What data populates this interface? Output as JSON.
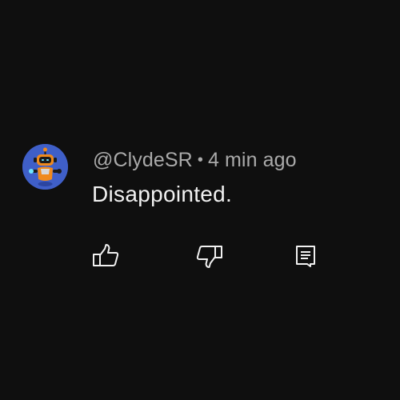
{
  "comment": {
    "author": "@ClydeSR",
    "separator": "•",
    "timestamp": "4 min ago",
    "text": "Disappointed."
  },
  "icons": {
    "avatar": "robot-avatar-icon",
    "like": "thumbs-up-icon",
    "dislike": "thumbs-down-icon",
    "reply": "comment-reply-icon"
  },
  "colors": {
    "background": "#0f0f0f",
    "author_text": "#aaaaaa",
    "comment_text": "#f1f1f1",
    "avatar_background": "#3f5fc8",
    "avatar_accent": "#f08a1c"
  }
}
